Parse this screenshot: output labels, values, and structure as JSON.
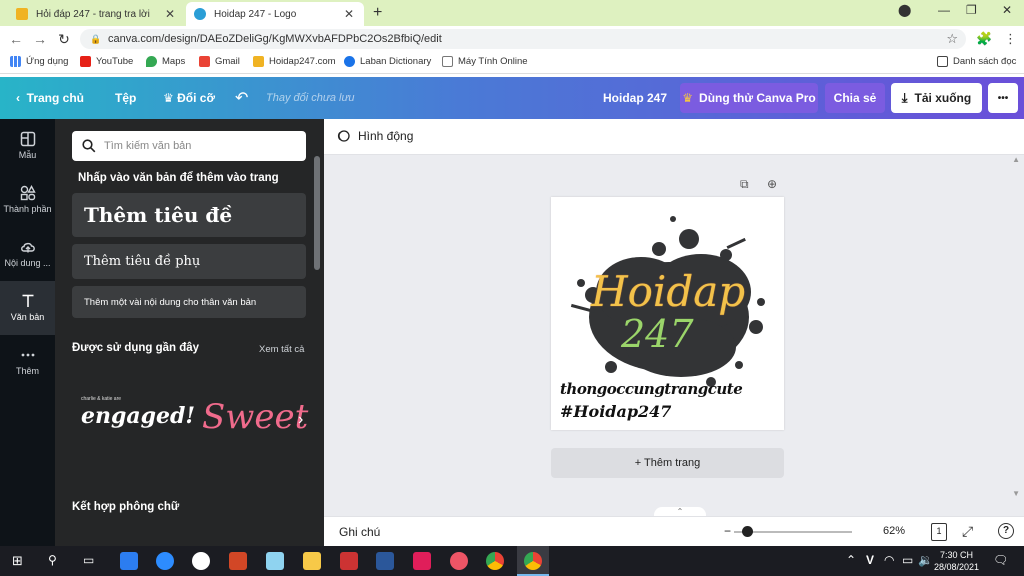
{
  "browser": {
    "tabs": [
      {
        "title": "Hỏi đáp 247 - trang tra lời",
        "close": "✕"
      },
      {
        "title": "Hoidap 247 - Logo",
        "close": "✕"
      }
    ],
    "new_tab": "+",
    "url": "canva.com/design/DAEoZDeliGg/KgMWXvbAFDPbC2Os2BfbiQ/edit",
    "bookmarks": [
      "Ứng dụng",
      "YouTube",
      "Maps",
      "Gmail",
      "Hoidap247.com",
      "Laban Dictionary",
      "Máy Tính Online"
    ],
    "reading_list": "Danh sách đọc"
  },
  "header": {
    "home": "Trang chủ",
    "file": "Tệp",
    "resize": "Đổi cỡ",
    "unsaved": "Thay đổi chưa lưu",
    "design_title": "Hoidap 247",
    "try_pro": "Dùng thử Canva Pro",
    "share": "Chia sẻ",
    "download": "Tải xuống",
    "more": "•••"
  },
  "rail": [
    {
      "label": "Mẫu"
    },
    {
      "label": "Thành phần"
    },
    {
      "label": "Nội dung ..."
    },
    {
      "label": "Văn bản"
    },
    {
      "label": "Thêm"
    }
  ],
  "panel": {
    "search_placeholder": "Tìm kiếm văn bản",
    "hint": "Nhấp vào văn bản để thêm vào trang",
    "add_heading": "Thêm tiêu đề",
    "add_subheading": "Thêm tiêu đề phụ",
    "add_body": "Thêm một vài nội dung cho thân văn bản",
    "recent_title": "Được sử dụng gần đây",
    "see_all": "Xem tất cả",
    "recent_1_small": "charlie & katie are",
    "recent_1_big": "engaged!",
    "recent_2": "Sweet",
    "combo_title": "Kết hợp phông chữ"
  },
  "canvas": {
    "animate": "Hình động",
    "logo_line1": "Hoidap",
    "logo_line2": "247",
    "tagline1": "thongoccungtrangcute",
    "tagline2": "#Hoidap247",
    "add_page": "+ Thêm trang"
  },
  "footer": {
    "notes": "Ghi chú",
    "zoom": "62%",
    "zoom_fraction": 0.11,
    "page_count": "1",
    "help": "?"
  },
  "taskbar": {
    "time": "7:30 CH",
    "date": "28/08/2021",
    "lang": "V"
  },
  "colors": {
    "header_start": "#28b4c8",
    "header_end": "#6a4fd9",
    "try_pro_bg": "#7b5ce0",
    "share_bg": "#7b5ce0",
    "recent_2": "#f06b8c",
    "logo_gold": "#f2c24a",
    "logo_green": "#9bd56a"
  }
}
